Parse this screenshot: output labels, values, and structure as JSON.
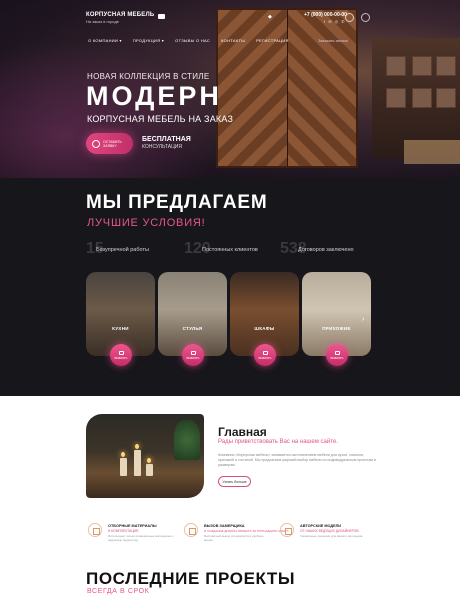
{
  "header": {
    "logo_title": "КОРПУСНАЯ МЕБЕЛЬ",
    "logo_sub": "На заказ в городе",
    "phone": "+7 (000) 000-00-00",
    "social": "f ✉ ◎ ✆",
    "nav": [
      "О КОМПАНИИ ▾",
      "ПРОДУКЦИЯ ▾",
      "ОТЗЫВЫ О НАС",
      "КОНТАКТЫ",
      "РЕГИСТРАЦИЯ"
    ],
    "nav_right": "Заказать звонок"
  },
  "hero": {
    "line1": "НОВАЯ КОЛЛЕКЦИЯ В СТИЛЕ",
    "title": "МОДЕРН",
    "line3": "КОРПУСНАЯ МЕБЕЛЬ НА ЗАКАЗ",
    "cta": "ОСТАВИТЬ ЗАЯВКУ",
    "free_title": "БЕСПЛАТНАЯ",
    "free_sub": "КОНСУЛЬТАЦИЯ"
  },
  "offer": {
    "title": "МЫ ПРЕДЛАГАЕМ",
    "subtitle": "ЛУЧШИЕ УСЛОВИЯ!",
    "stats": [
      {
        "num": "15",
        "label": "Безупречной работы"
      },
      {
        "num": "120",
        "label": "Постоянных клиентов"
      },
      {
        "num": "538",
        "label": "Договоров заключено"
      }
    ],
    "cards": [
      {
        "caption": "КУХНИ",
        "button": "ВЫБРАТЬ"
      },
      {
        "caption": "СТУЛЬЯ",
        "button": "ВЫБРАТЬ"
      },
      {
        "caption": "ШКАФЫ",
        "button": "ВЫБРАТЬ"
      },
      {
        "caption": "ПРИХОЖИЕ",
        "button": "ВЫБРАТЬ"
      }
    ],
    "next_arrow": "›"
  },
  "main": {
    "title": "Главная",
    "subtitle": "Рады приветствовать Вас на нашем сайте.",
    "text": "Компания «Корпусная мебель» занимается изготовлением мебели для кухни, спальни, прихожей и гостиной. Мы предлагаем широкий выбор мебели по индивидуальным проектам и размерам.",
    "more": "Узнать больше"
  },
  "features": [
    {
      "t1": "ОТБОРНЫЕ МАТЕРИАЛЫ",
      "t2": "И КОМПЛЕКТАЦИЯ",
      "t3": "Используем только проверенные материалы и надежную фурнитуру."
    },
    {
      "t1": "ВЫЗОВ ЗАМЕРЩИКА",
      "t2": "И СОЗДАНИЕ ДИЗАЙН-ПРОЕКТА ЗА ПЯТНАДЦАТЬ МИНУТ",
      "t3": "Бесплатный выезд специалиста в удобное время."
    },
    {
      "t1": "АВТОРСКИЕ МОДЕЛИ",
      "t2": "ОТ НАШИХ ВЕДУЩИХ ДИЗАЙНЕРОВ",
      "t3": "Уникальные решения для вашего интерьера."
    }
  ],
  "projects": {
    "title": "ПОСЛЕДНИЕ ПРОЕКТЫ",
    "subtitle": "ВСЕГДА В СРОК"
  }
}
